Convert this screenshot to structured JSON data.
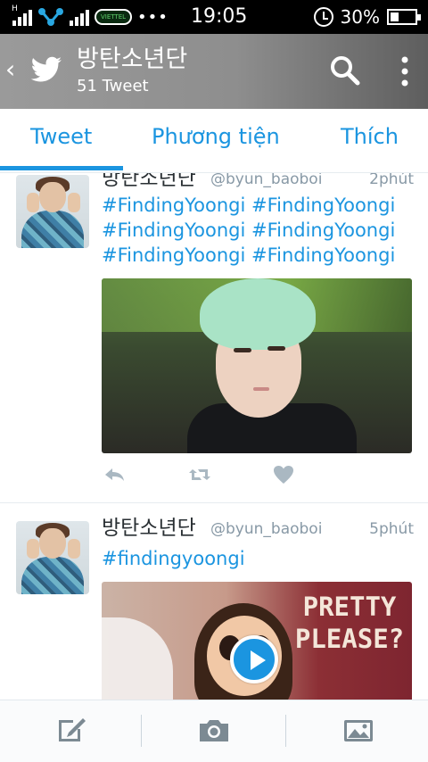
{
  "status_bar": {
    "time": "19:05",
    "battery": "30%",
    "network_label": "H",
    "carrier_logo": "VIETTEL"
  },
  "app_bar": {
    "title": "방탄소년단",
    "subtitle": "51 Tweet"
  },
  "tabs": [
    {
      "label": "Tweet",
      "active": true
    },
    {
      "label": "Phương tiện",
      "active": false
    },
    {
      "label": "Thích",
      "active": false
    }
  ],
  "tweets": [
    {
      "name": "방탄소년단",
      "handle": "@byun_baoboi",
      "time": "2phút",
      "lines": [
        "#FindingYoongi #FindingYoongi",
        "#FindingYoongi #FindingYoongi",
        "#FindingYoongi #FindingYoongi"
      ],
      "media": "photo"
    },
    {
      "name": "방탄소년단",
      "handle": "@byun_baoboi",
      "time": "5phút",
      "lines": [
        "#findingyoongi"
      ],
      "media": "video",
      "media_text": "PRETTY PLEASE?"
    }
  ],
  "colors": {
    "accent": "#1b95e0",
    "app_bar": "#8e8e8e",
    "muted": "#8899a6"
  },
  "icons": {
    "back": "back-icon",
    "logo": "twitter-bird-icon",
    "search": "search-icon",
    "more": "more-vertical-icon",
    "reply": "reply-icon",
    "retweet": "retweet-icon",
    "like": "heart-icon",
    "compose": "compose-icon",
    "camera": "camera-icon",
    "gallery": "image-icon"
  }
}
